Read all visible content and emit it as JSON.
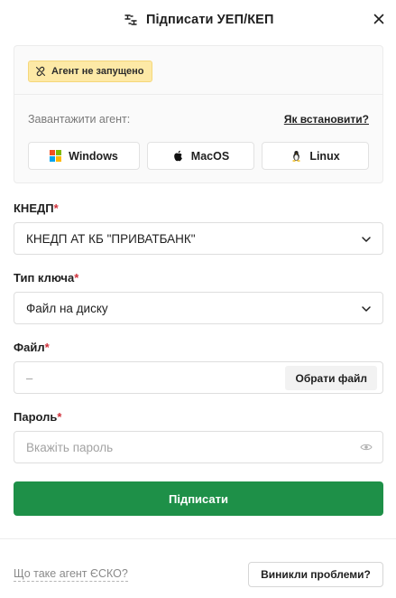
{
  "header": {
    "title": "Підписати УЕП/КЕП",
    "title_icon": "sign-key-icon",
    "close_icon": "close-icon"
  },
  "agent": {
    "status_text": "Агент не запущено",
    "status_icon": "link-icon",
    "status_color": "#fde9a6",
    "download_label": "Завантажити агент:",
    "install_link": "Як встановити?",
    "os_buttons": [
      {
        "label": "Windows",
        "icon": "windows-icon"
      },
      {
        "label": "MacOS",
        "icon": "apple-icon"
      },
      {
        "label": "Linux",
        "icon": "linux-icon"
      }
    ]
  },
  "form": {
    "kned": {
      "label": "КНЕДП",
      "required_mark": "*",
      "value": "КНЕДП АТ КБ \"ПРИВАТБАНК\""
    },
    "key_type": {
      "label": "Тип ключа",
      "required_mark": "*",
      "value": "Файл на диску"
    },
    "file": {
      "label": "Файл",
      "required_mark": "*",
      "value": "–",
      "choose_button": "Обрати файл"
    },
    "password": {
      "label": "Пароль",
      "required_mark": "*",
      "placeholder": "Вкажіть пароль"
    },
    "submit_label": "Підписати"
  },
  "footer": {
    "what_is_link": "Що таке агент ЄСКО?",
    "problems_button": "Виникли проблеми?"
  },
  "colors": {
    "primary": "#1e9048",
    "required": "#d0303a",
    "badge": "#fde9a6"
  }
}
